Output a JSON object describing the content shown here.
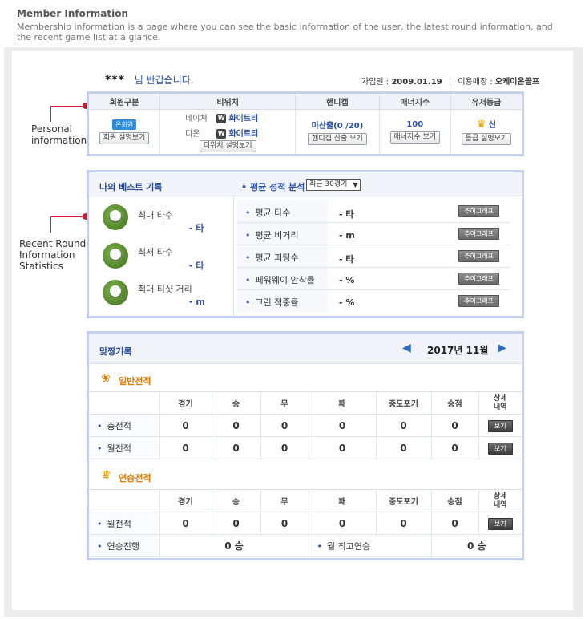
{
  "header": {
    "title": "Member Information",
    "description": "Membership information is a page where you can see the basic information of the user, the latest round information, and the recent game list at a glance."
  },
  "side_labels": {
    "personal": "Personal information",
    "personal_line1": "Personal",
    "personal_line2": "information",
    "recent_line1": "Recent Round",
    "recent_line2": "Information",
    "recent_line3": "Statistics"
  },
  "greeting": {
    "name": "***",
    "text": "님 반갑습니다."
  },
  "join": {
    "label": "가입일 :",
    "date": "2009.01.19",
    "sep": "|",
    "store_label": "이용매장 :",
    "store": "오케이온골프"
  },
  "member_table": {
    "headers": [
      "회원구분",
      "티위치",
      "핸디캡",
      "매너지수",
      "유저등급"
    ],
    "member_type": {
      "badge": "온회원",
      "button": "회원 설명보기"
    },
    "tee": {
      "row1_label": "네이쳐",
      "row1_icon": "W",
      "row1_value": "화이트티",
      "row2_label": "디온",
      "row2_icon": "W",
      "row2_value": "화이트티",
      "button": "티위치 설명보기"
    },
    "handicap": {
      "value": "미산출(0 /20)",
      "button": "핸디캡 산출 보기"
    },
    "manner": {
      "value": "100",
      "button": "매너지수 보기"
    },
    "grade": {
      "icon": "crown-icon",
      "value": "신",
      "button": "등급 설명보기"
    }
  },
  "best": {
    "title": "나의 베스트 기록",
    "items": [
      {
        "label": "최대 타수",
        "value": "- 타"
      },
      {
        "label": "최저 타수",
        "value": "- 타"
      },
      {
        "label": "최대 티샷 거리",
        "value": "- m"
      }
    ]
  },
  "analysis": {
    "title": "평균 성적 분석",
    "select": "최근 30경기",
    "button": "추이그래프",
    "rows": [
      {
        "label": "평균 타수",
        "value": "- 타"
      },
      {
        "label": "평균 비거리",
        "value": "- m"
      },
      {
        "label": "평균 퍼팅수",
        "value": "- 타"
      },
      {
        "label": "페워웨이 안착률",
        "value": "- %"
      },
      {
        "label": "그린 적중률",
        "value": "- %"
      }
    ]
  },
  "records": {
    "title": "맞짱기록",
    "month": "2017년 11월",
    "general": {
      "title": "일반전적",
      "headers": [
        "경기",
        "승",
        "무",
        "패",
        "중도포기",
        "승점",
        "상세\n내역"
      ],
      "detail_line1": "상세",
      "detail_line2": "내역",
      "rows": [
        {
          "label": "총전적",
          "values": [
            "0",
            "0",
            "0",
            "0",
            "0",
            "0"
          ],
          "button": "보기"
        },
        {
          "label": "월전적",
          "values": [
            "0",
            "0",
            "0",
            "0",
            "0",
            "0"
          ],
          "button": "보기"
        }
      ]
    },
    "streak": {
      "title": "연승전적",
      "headers": [
        "경기",
        "승",
        "무",
        "패",
        "중도포기",
        "승점"
      ],
      "detail_line1": "상세",
      "detail_line2": "내역",
      "row": {
        "label": "월전적",
        "values": [
          "0",
          "0",
          "0",
          "0",
          "0",
          "0"
        ],
        "button": "보기"
      },
      "progress_label": "연승진행",
      "progress_value": "0 승",
      "best_label": "월 최고연승",
      "best_value": "0 승"
    }
  },
  "colors": {
    "accent": "#2a4fa8",
    "border": "#c4d0ee",
    "marker": "#d7192a",
    "orange": "#e07b00"
  }
}
